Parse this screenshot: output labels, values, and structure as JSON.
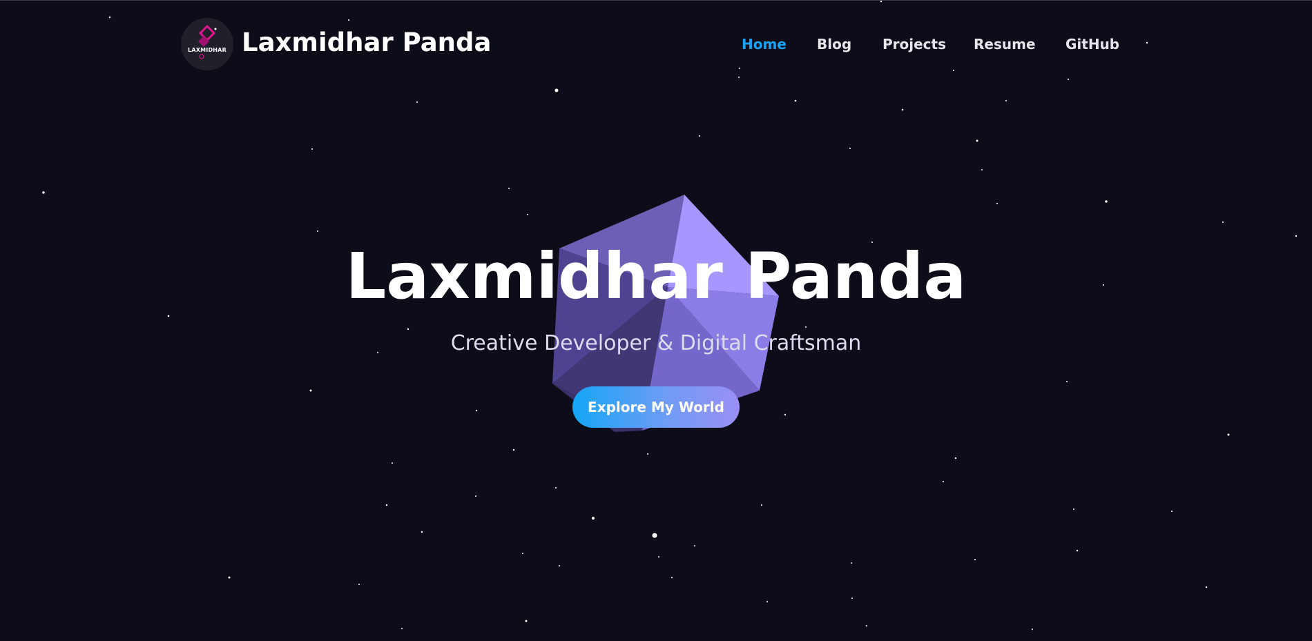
{
  "header": {
    "logo_text": "LAXMIDHAR",
    "brand_name": "Laxmidhar Panda",
    "nav": [
      {
        "label": "Home",
        "active": true
      },
      {
        "label": "Blog",
        "active": false
      },
      {
        "label": "Projects",
        "active": false
      },
      {
        "label": "Resume",
        "active": false
      },
      {
        "label": "GitHub",
        "active": false
      }
    ]
  },
  "hero": {
    "title": "Laxmidhar Panda",
    "subtitle": "Creative Developer & Digital Craftsman",
    "cta_label": "Explore My World"
  },
  "colors": {
    "background": "#0c0d18",
    "accent": "#1aa3f5",
    "gem_light": "#a697ff",
    "gem_dark": "#4a3f86"
  },
  "icons": {
    "logo": "diamond-logo-icon",
    "decoration": "3d-gem-icon"
  }
}
